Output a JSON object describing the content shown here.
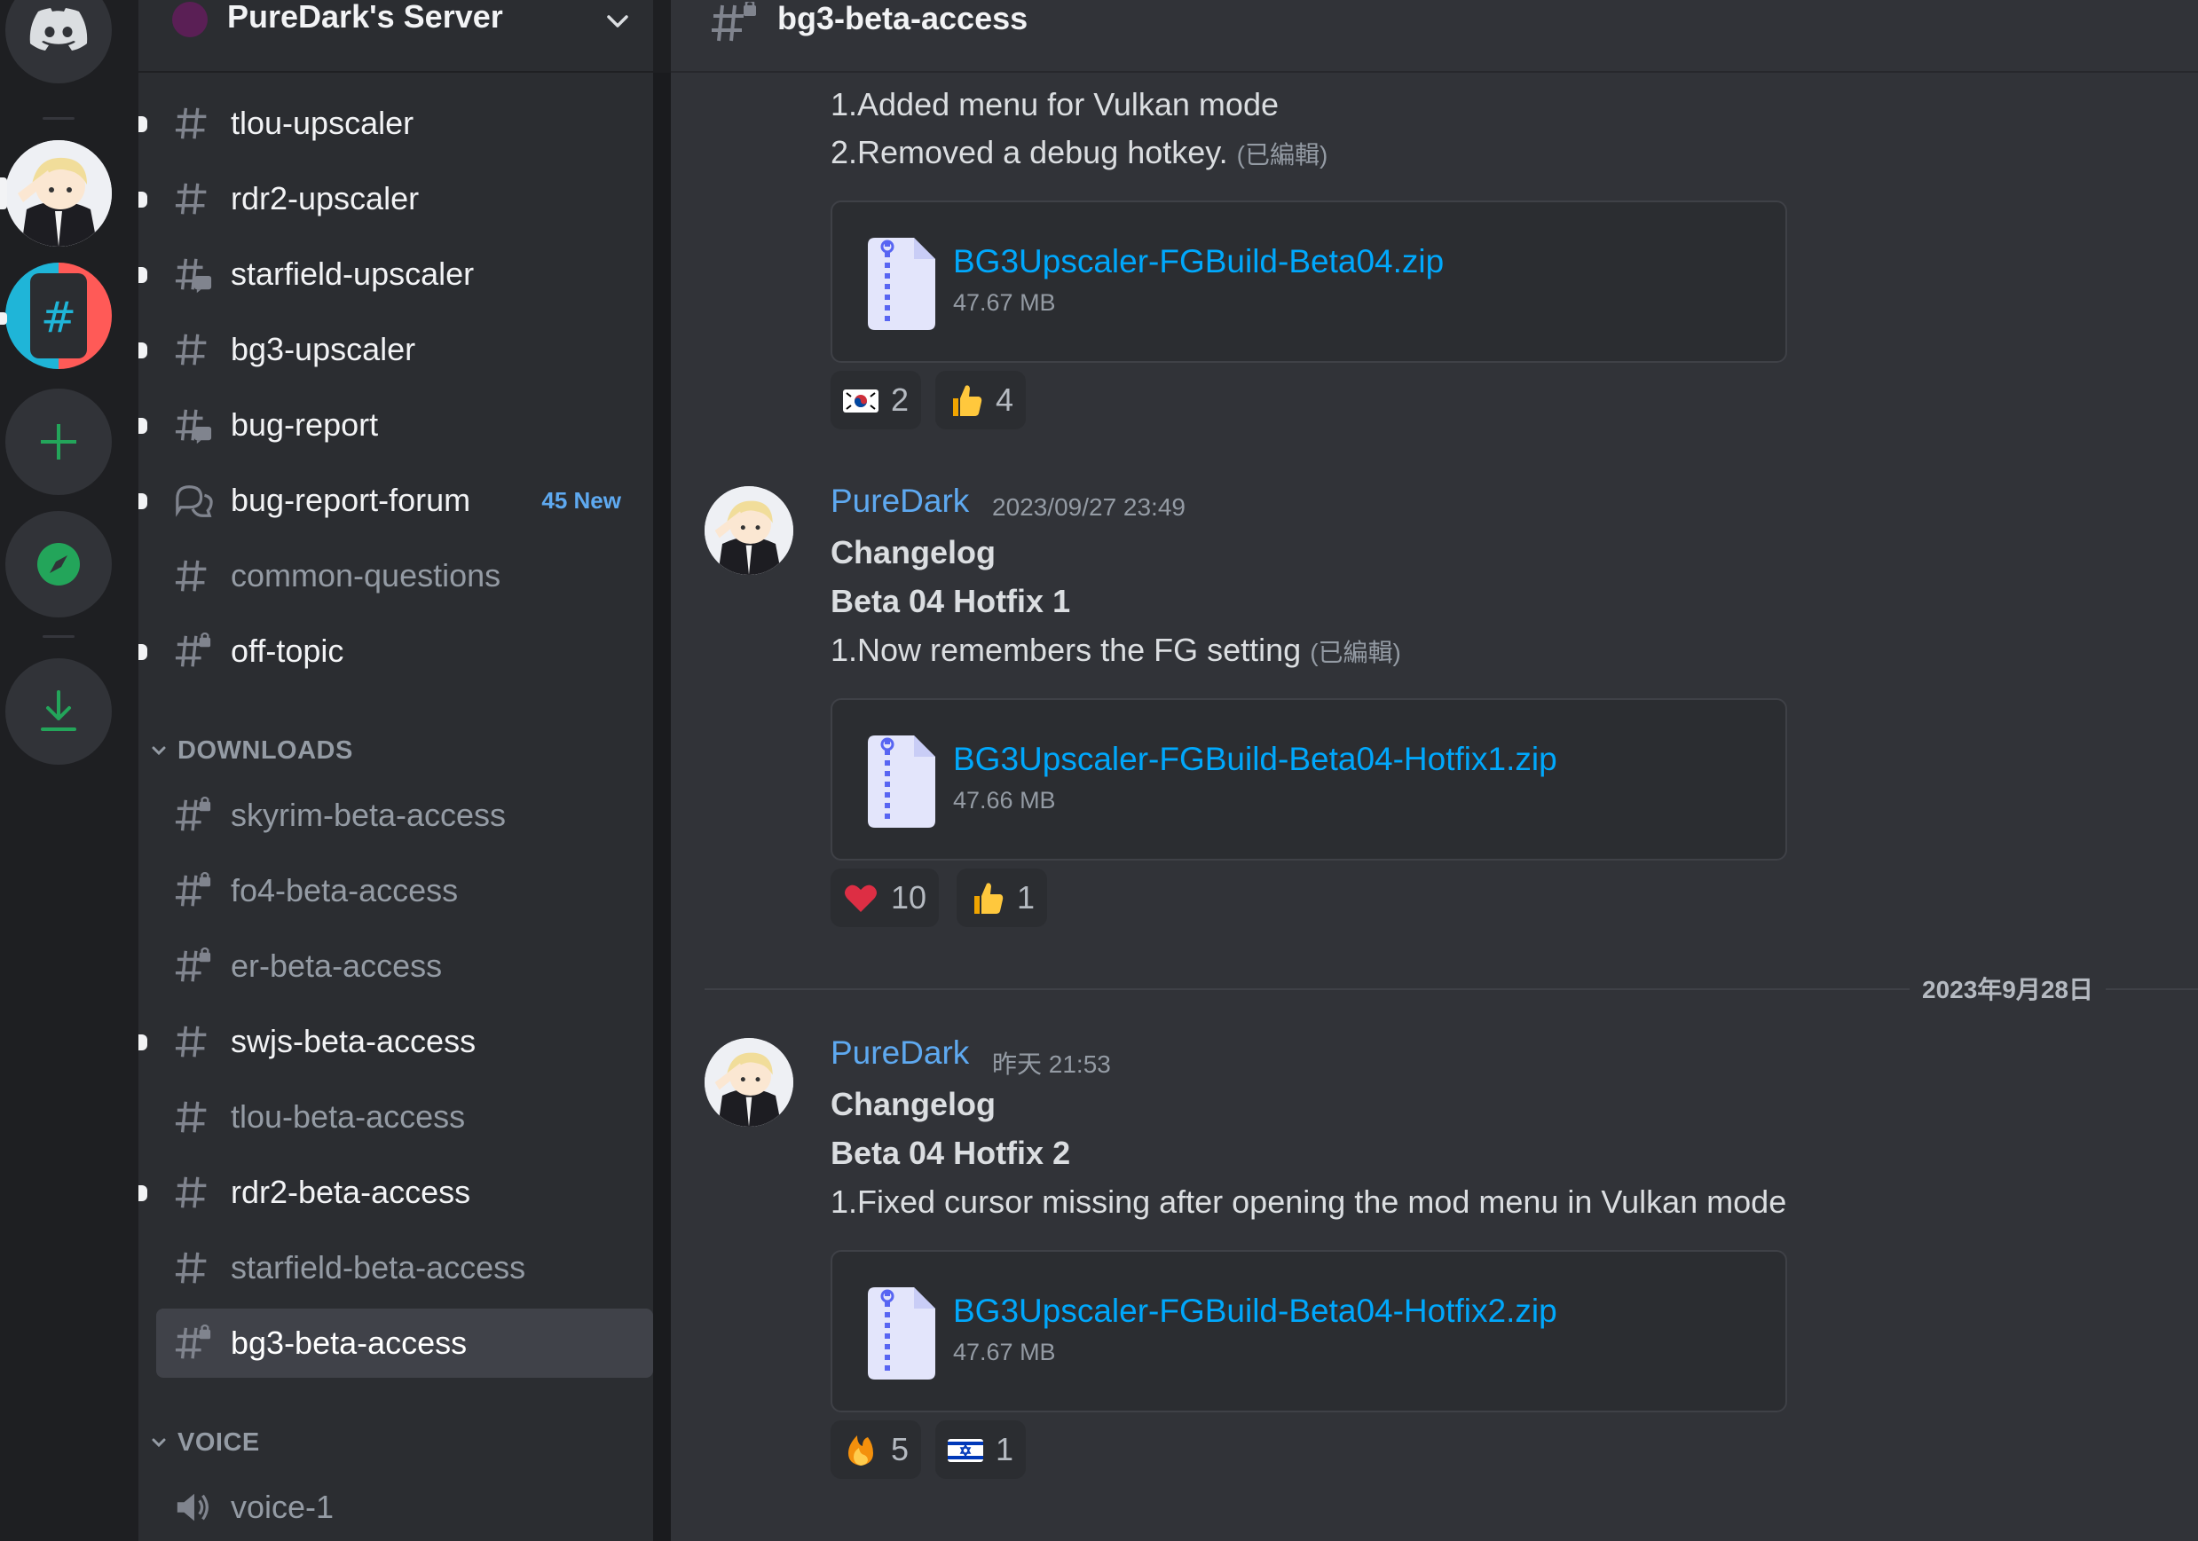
{
  "server": {
    "name": "PureDark's Server"
  },
  "channels": [
    {
      "label": "tlou-upscaler",
      "icon": "hash-icon",
      "unread": true
    },
    {
      "label": "rdr2-upscaler",
      "icon": "hash-icon",
      "unread": true
    },
    {
      "label": "starfield-upscaler",
      "icon": "hash-thread-icon",
      "unread": true
    },
    {
      "label": "bg3-upscaler",
      "icon": "hash-icon",
      "unread": true
    },
    {
      "label": "bug-report",
      "icon": "hash-thread-icon",
      "unread": true
    },
    {
      "label": "bug-report-forum",
      "icon": "forum-icon",
      "unread": true,
      "badge": "45 New"
    },
    {
      "label": "common-questions",
      "icon": "hash-icon",
      "unread": false
    },
    {
      "label": "off-topic",
      "icon": "hash-lock-icon",
      "unread": true
    }
  ],
  "categories": {
    "downloads": "DOWNLOADS",
    "voice": "VOICE"
  },
  "downloads": [
    {
      "label": "skyrim-beta-access",
      "icon": "hash-lock-icon",
      "unread": false
    },
    {
      "label": "fo4-beta-access",
      "icon": "hash-lock-icon",
      "unread": false
    },
    {
      "label": "er-beta-access",
      "icon": "hash-lock-icon",
      "unread": false
    },
    {
      "label": "swjs-beta-access",
      "icon": "hash-icon",
      "unread": true
    },
    {
      "label": "tlou-beta-access",
      "icon": "hash-icon",
      "unread": false
    },
    {
      "label": "rdr2-beta-access",
      "icon": "hash-icon",
      "unread": true
    },
    {
      "label": "starfield-beta-access",
      "icon": "hash-icon",
      "unread": false
    },
    {
      "label": "bg3-beta-access",
      "icon": "hash-lock-icon",
      "unread": false,
      "selected": true
    }
  ],
  "voice": [
    {
      "label": "voice-1",
      "icon": "speaker-icon"
    }
  ],
  "header": {
    "title": "bg3-beta-access"
  },
  "messages": {
    "m0": {
      "line1": "1.Added menu for Vulkan mode",
      "line2": "2.Removed a debug hotkey.",
      "edited": "(已編輯)",
      "file_name": "BG3Upscaler-FGBuild-Beta04.zip",
      "file_size": "47.67 MB",
      "reactions": [
        {
          "emoji": "flag-south-korea",
          "count": "2"
        },
        {
          "emoji": "thumbs-up",
          "count": "4"
        }
      ]
    },
    "m1": {
      "author": "PureDark",
      "timestamp": "2023/09/27 23:49",
      "title": "Changelog",
      "subtitle": "Beta 04 Hotfix 1",
      "line1": "1.Now remembers the FG setting",
      "edited": "(已編輯)",
      "file_name": "BG3Upscaler-FGBuild-Beta04-Hotfix1.zip",
      "file_size": "47.66 MB",
      "reactions": [
        {
          "emoji": "red-heart",
          "count": "10"
        },
        {
          "emoji": "thumbs-up",
          "count": "1"
        }
      ]
    },
    "date_divider": "2023年9月28日",
    "m2": {
      "author": "PureDark",
      "timestamp": "昨天 21:53",
      "title": "Changelog",
      "subtitle": "Beta 04 Hotfix 2",
      "line1": "1.Fixed cursor missing after opening the mod menu in Vulkan mode",
      "file_name": "BG3Upscaler-FGBuild-Beta04-Hotfix2.zip",
      "file_size": "47.67 MB",
      "reactions": [
        {
          "emoji": "fire",
          "count": "5"
        },
        {
          "emoji": "flag-israel",
          "count": "1"
        }
      ]
    }
  },
  "colors": {
    "accent_blue": "#5ea9f0",
    "link": "#00a8fc",
    "green": "#23a55a",
    "background": "#313338",
    "sidebar": "#2b2d31"
  }
}
